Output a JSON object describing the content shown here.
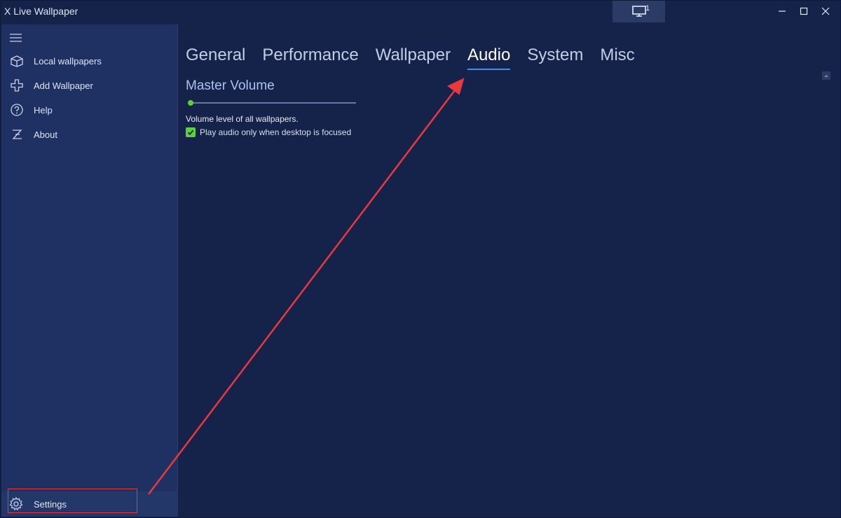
{
  "window": {
    "title": "X Live Wallpaper",
    "monitor_count": "1"
  },
  "sidebar": {
    "items": [
      {
        "label": "Local wallpapers",
        "icon": "local-wallpapers-icon"
      },
      {
        "label": "Add Wallpaper",
        "icon": "plus-icon"
      },
      {
        "label": "Help",
        "icon": "help-icon"
      },
      {
        "label": "About",
        "icon": "about-icon"
      }
    ],
    "settings_label": "Settings"
  },
  "tabs": [
    {
      "label": "General"
    },
    {
      "label": "Performance"
    },
    {
      "label": "Wallpaper"
    },
    {
      "label": "Audio",
      "active": true
    },
    {
      "label": "System"
    },
    {
      "label": "Misc"
    }
  ],
  "audio": {
    "section_title": "Master Volume",
    "volume_level": 0,
    "description": "Volume level of all wallpapers.",
    "checkbox_label": "Play audio only when desktop is focused",
    "checkbox_checked": true
  },
  "colors": {
    "background": "#15234a",
    "sidebar": "#1f3163",
    "accent_tab": "#3d8fe8",
    "accent_green": "#5fcf3c",
    "annotation_red": "#e8393f"
  }
}
